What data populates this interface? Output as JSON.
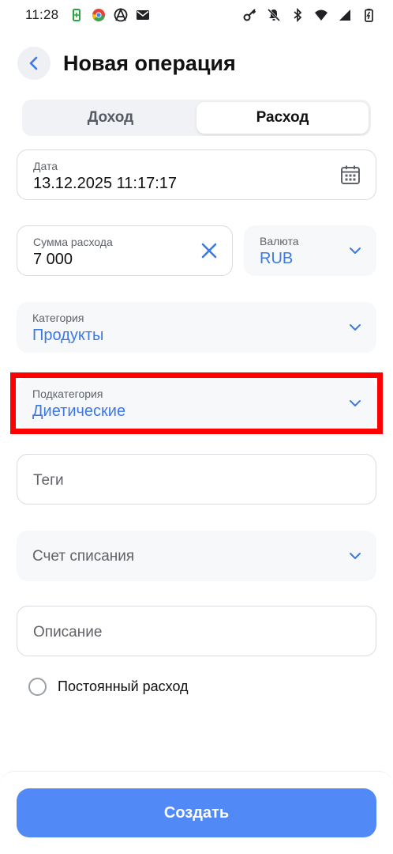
{
  "status_bar": {
    "time": "11:28",
    "left_icons": [
      "battery-saver-icon",
      "chrome-icon",
      "anarchy-icon",
      "mail-icon"
    ],
    "right_icons": [
      "key-icon",
      "mute-icon",
      "bluetooth-icon",
      "wifi-icon",
      "signal-icon",
      "battery-charging-icon"
    ]
  },
  "header": {
    "title": "Новая операция",
    "back_icon": "arrow-left-icon"
  },
  "tabs": [
    {
      "label": "Доход",
      "active": false
    },
    {
      "label": "Расход",
      "active": true
    }
  ],
  "form": {
    "date": {
      "label": "Дата",
      "value": "13.12.2025 11:17:17",
      "icon": "calendar-icon"
    },
    "amount": {
      "label": "Сумма расхода",
      "value": "7 000",
      "icon": "clear-icon"
    },
    "currency": {
      "label": "Валюта",
      "value": "RUB",
      "icon": "chevron-down-icon"
    },
    "category": {
      "label": "Категория",
      "value": "Продукты",
      "icon": "chevron-down-icon"
    },
    "subcategory": {
      "label": "Подкатегория",
      "value": "Диетические",
      "icon": "chevron-down-icon"
    },
    "tags": {
      "placeholder": "Теги"
    },
    "account": {
      "placeholder": "Счет списания",
      "icon": "chevron-down-icon"
    },
    "description": {
      "placeholder": "Описание"
    },
    "recurring": {
      "label": "Постоянный расход",
      "checked": false
    }
  },
  "actions": {
    "create_label": "Создать"
  },
  "colors": {
    "accent": "#3c78e6",
    "button": "#5189f7",
    "highlight": "#ff0000"
  }
}
